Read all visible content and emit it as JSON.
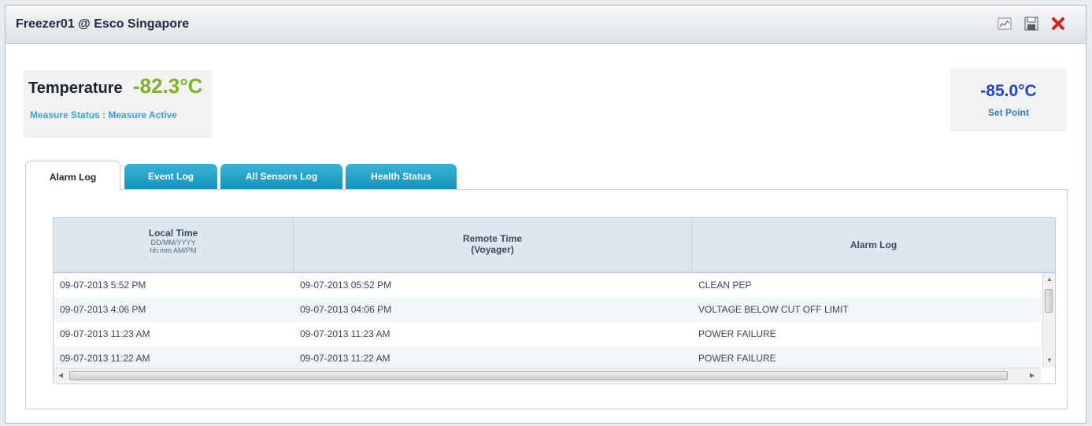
{
  "window": {
    "title": "Freezer01 @ Esco Singapore",
    "icons": [
      "chart-icon",
      "save-icon",
      "close-icon"
    ]
  },
  "temperature": {
    "label": "Temperature",
    "value": "-82.3°C",
    "measure_status": "Measure Status : Measure Active",
    "value_color": "#7db223"
  },
  "set_point": {
    "value": "-85.0°C",
    "label": "Set Point"
  },
  "tabs": [
    {
      "label": "Alarm Log",
      "active": true
    },
    {
      "label": "Event Log",
      "active": false
    },
    {
      "label": "All Sensors Log",
      "active": false
    },
    {
      "label": "Health Status",
      "active": false
    }
  ],
  "table": {
    "columns": [
      {
        "title": "Local Time",
        "sub1": "DD/MM/YYYY",
        "sub2": "hh:mm AM/PM"
      },
      {
        "title": "Remote Time",
        "sub1": "(Voyager)",
        "sub2": ""
      },
      {
        "title": "Alarm Log",
        "sub1": "",
        "sub2": ""
      }
    ],
    "rows": [
      [
        "09-07-2013 5:52 PM",
        "09-07-2013 05:52 PM",
        "CLEAN PEP"
      ],
      [
        "09-07-2013 4:06 PM",
        "09-07-2013 04:06 PM",
        "VOLTAGE BELOW CUT OFF LIMIT"
      ],
      [
        "09-07-2013 11:23 AM",
        "09-07-2013 11:23 AM",
        "POWER FAILURE"
      ],
      [
        "09-07-2013 11:22 AM",
        "09-07-2013 11:22 AM",
        "POWER FAILURE"
      ]
    ]
  }
}
